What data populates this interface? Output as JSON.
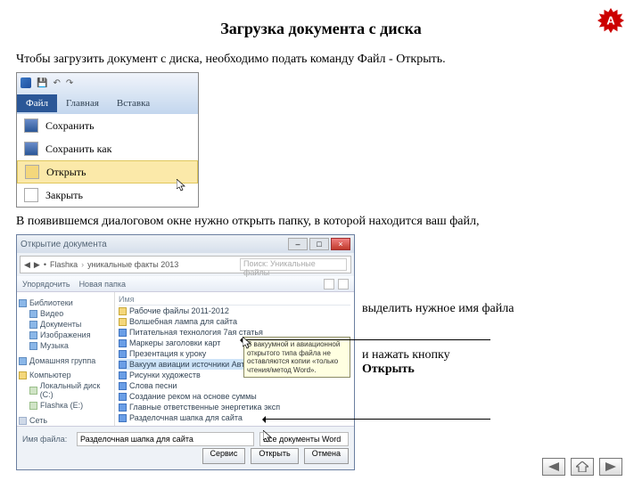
{
  "title": "Загрузка документа с диска",
  "intro": "Чтобы загрузить документ с диска, необходимо подать команду Файл - Открыть.",
  "ribbon": {
    "file": "Файл",
    "home": "Главная",
    "insert": "Вставка"
  },
  "menu": {
    "save": "Сохранить",
    "saveas": "Сохранить как",
    "open": "Открыть",
    "close": "Закрыть"
  },
  "body2": "В появившемся диалоговом окне нужно открыть папку, в которой находится ваш файл,",
  "dialog": {
    "title": "Открытие документа",
    "path": {
      "root": "Flashка",
      "folder": "уникальные факты 2013"
    },
    "search_ph": "Поиск: Уникальные файлы",
    "toolbar": {
      "org": "Упорядочить",
      "newf": "Новая папка"
    },
    "nav": {
      "libs": "Библиотеки",
      "lib_items": [
        "Видео",
        "Документы",
        "Изображения",
        "Музыка"
      ],
      "home": "Домашняя группа",
      "computer": "Компьютер",
      "drives": [
        "Локальный диск (C:)",
        "Flashка (E:)"
      ],
      "network": "Сеть"
    },
    "files_header": "Имя",
    "files": [
      {
        "t": "folder",
        "n": "Рабочие файлы 2011-2012"
      },
      {
        "t": "folder",
        "n": "Волшебная лампа для сайта"
      },
      {
        "t": "doc",
        "n": "Питательная технология 7ая статья"
      },
      {
        "t": "doc",
        "n": "Маркеры заголовки карт"
      },
      {
        "t": "doc",
        "n": "Презентация к уроку"
      },
      {
        "t": "doc",
        "n": "Вакуум авиации источники Авто 2 статья"
      },
      {
        "t": "doc",
        "n": "Рисунки художеств"
      },
      {
        "t": "doc",
        "n": "Слова песни"
      },
      {
        "t": "doc",
        "n": "Создание реком на основе суммы"
      },
      {
        "t": "doc",
        "n": "Главные ответственные энергетика эксп"
      },
      {
        "t": "doc",
        "n": "Разделочная шапка для сайта"
      }
    ],
    "selected_index": 5,
    "tooltip": "В вакуумной и авиационной открытого типа файла не оставляются копии «только чтения/метод Word».",
    "bottom": {
      "fname_label": "Имя файла:",
      "fname_value": "Разделочная шапка для сайта",
      "filter": "Все документы Word",
      "tools": "Сервис",
      "open": "Открыть",
      "cancel": "Отмена"
    }
  },
  "annot1": "выделить нужное имя файла",
  "annot2a": "и нажать кнопку",
  "annot2b": "Открыть"
}
